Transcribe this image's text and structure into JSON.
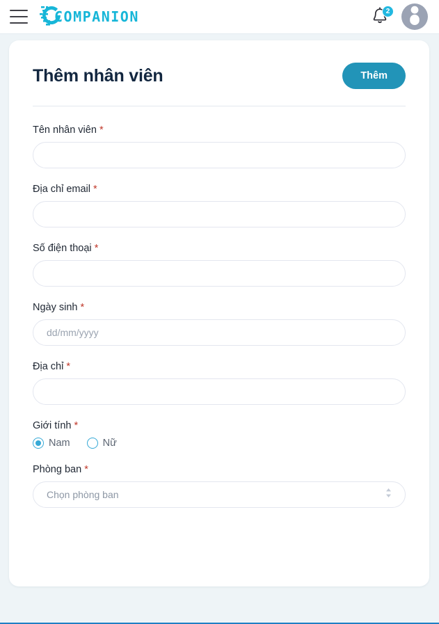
{
  "topbar": {
    "menu_icon": "hamburger-menu-icon",
    "brand_name": "COMPANION",
    "brand_color": "#17b6d8",
    "bell_icon": "bell-icon",
    "notification_count": "2",
    "badge_color": "#22b8e0",
    "avatar_icon": "user-avatar-icon"
  },
  "card": {
    "title": "Thêm nhân viên",
    "primary_button": "Thêm",
    "primary_button_color": "#2294b8"
  },
  "form": {
    "fields": [
      {
        "label": "Tên nhân viên",
        "required": "*",
        "value": "",
        "placeholder": ""
      },
      {
        "label": "Địa chỉ email",
        "required": "*",
        "value": "",
        "placeholder": ""
      },
      {
        "label": "Số điện thoại",
        "required": "*",
        "value": "",
        "placeholder": ""
      },
      {
        "label": "Ngày sinh",
        "required": "*",
        "value": "",
        "placeholder": "dd/mm/yyyy"
      },
      {
        "label": "Địa chỉ",
        "required": "*",
        "value": "",
        "placeholder": ""
      }
    ],
    "gender": {
      "label": "Giới tính",
      "required": "*",
      "options": [
        {
          "label": "Nam",
          "selected": true
        },
        {
          "label": "Nữ",
          "selected": false
        }
      ],
      "accent_color": "#36a9d6"
    },
    "department": {
      "label": "Phòng ban",
      "required": "*",
      "selected": "Chọn phòng ban",
      "chevron_icon": "chevron-up-down-icon"
    }
  }
}
